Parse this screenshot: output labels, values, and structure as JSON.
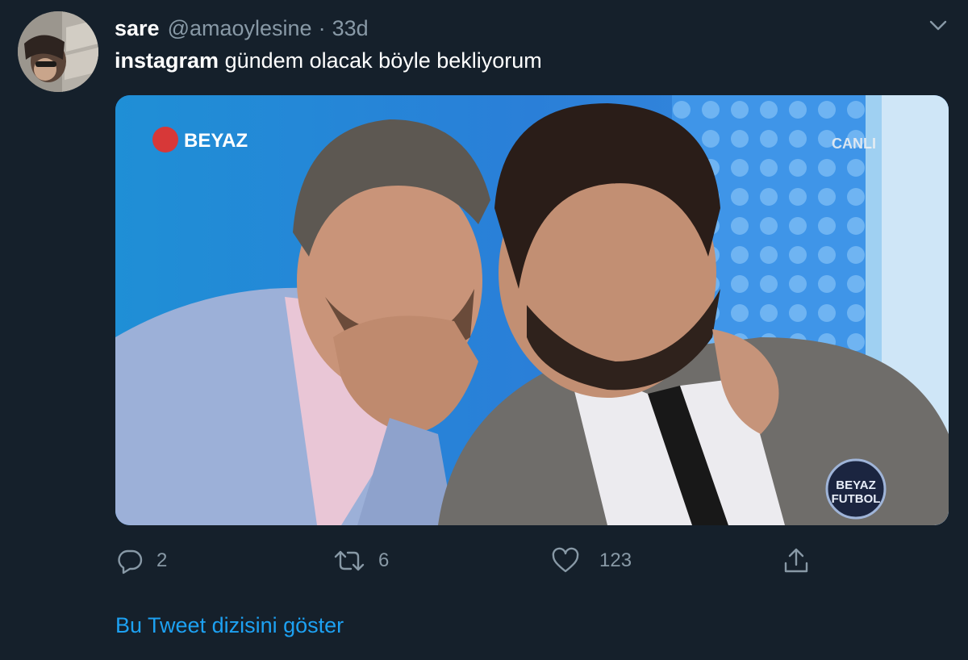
{
  "tweet": {
    "display_name": "sare",
    "handle": "@amaoylesine",
    "separator": "·",
    "time": "33d",
    "text_bold": "instagram",
    "text_rest": "gündem olacak böyle bekliyorum"
  },
  "media": {
    "channel_logo": "BEYAZ",
    "live_badge": "CANLI",
    "program_logo_line1": "BEYAZ",
    "program_logo_line2": "FUTBOL"
  },
  "actions": {
    "reply_count": "2",
    "retweet_count": "6",
    "like_count": "123"
  },
  "icons": {
    "caret": "chevron-down-icon",
    "reply": "reply-icon",
    "retweet": "retweet-icon",
    "like": "heart-icon",
    "share": "share-icon"
  },
  "colors": {
    "background": "#15202b",
    "secondary_text": "#8899a6",
    "link": "#1da1f2"
  },
  "show_thread": "Bu Tweet dizisini göster"
}
